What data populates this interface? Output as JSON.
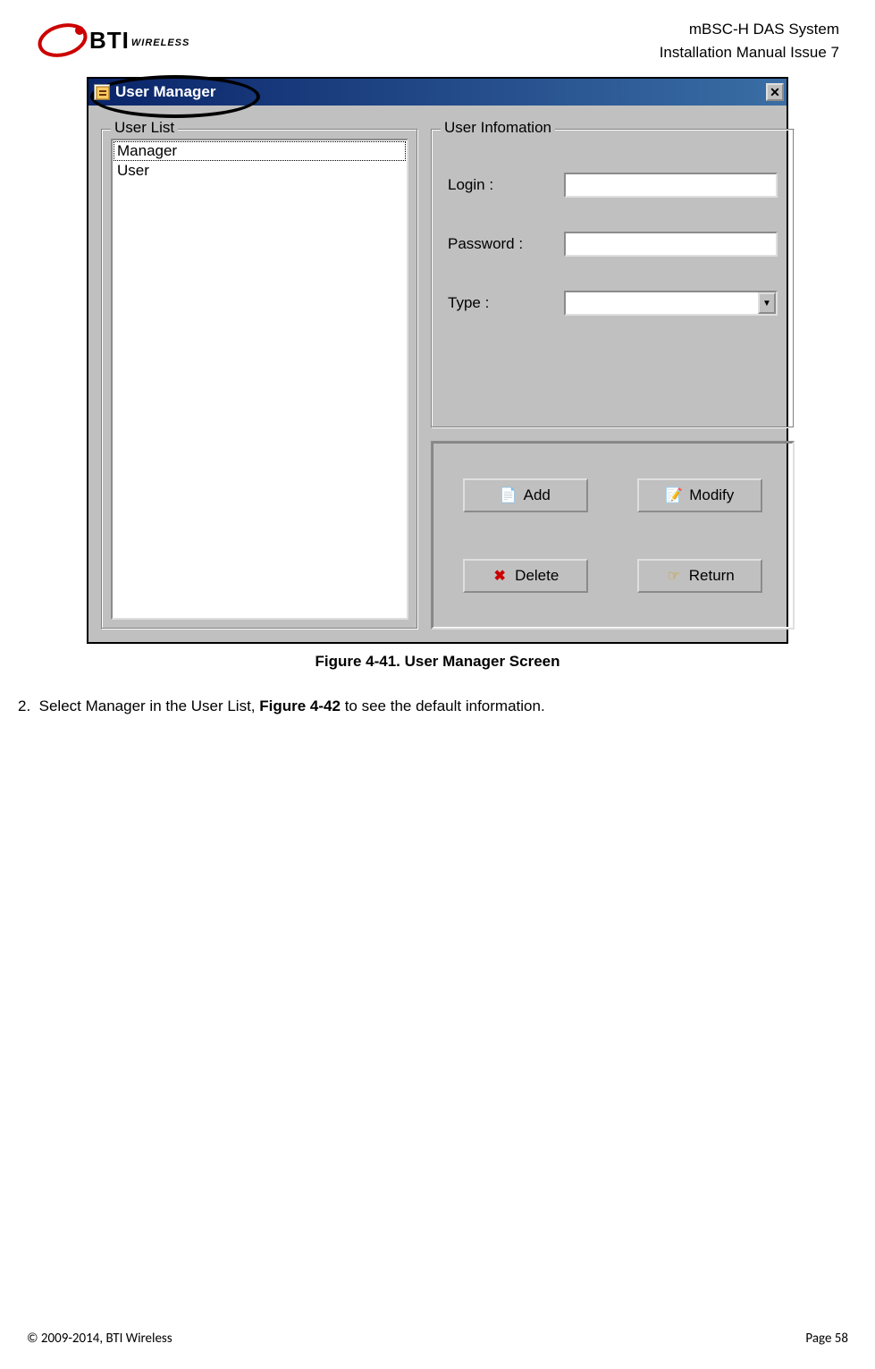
{
  "header": {
    "logo_main": "BTI",
    "logo_sub": "WIRELESS",
    "line1": "mBSC-H DAS System",
    "line2": "Installation Manual Issue 7"
  },
  "window": {
    "title": "User Manager",
    "close": "✕",
    "user_list": {
      "legend": "User List",
      "items": [
        "Manager",
        "User"
      ]
    },
    "user_info": {
      "legend": "User Infomation",
      "login_label": "Login :",
      "login_value": "",
      "password_label": "Password :",
      "password_value": "",
      "type_label": "Type :",
      "type_value": ""
    },
    "buttons": {
      "add": "Add",
      "modify": "Modify",
      "delete": "Delete",
      "return": "Return"
    }
  },
  "caption": "Figure 4-41. User Manager Screen",
  "step": {
    "num": "2.",
    "pre": "Select Manager in the User List, ",
    "bold": "Figure 4-42",
    "post": " to see the default information."
  },
  "footer": {
    "left": "© 2009-2014, BTI Wireless",
    "right": "Page 58"
  }
}
